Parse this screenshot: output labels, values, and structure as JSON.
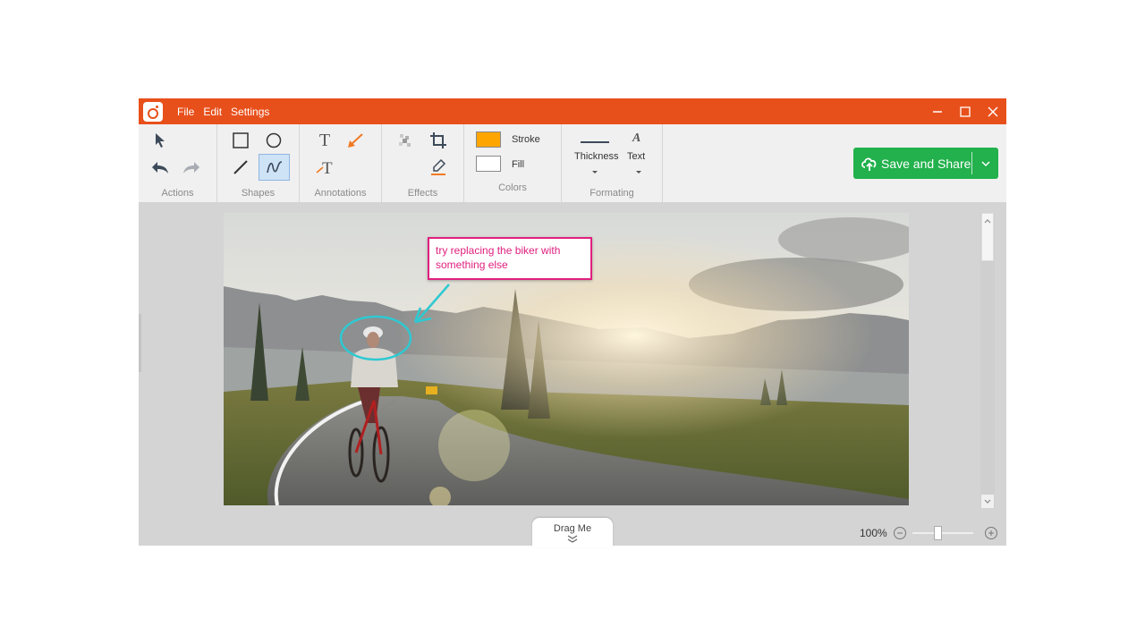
{
  "window": {
    "menu": [
      "File",
      "Edit",
      "Settings"
    ],
    "controls": {
      "minimize": "minimize-icon",
      "maximize": "maximize-icon",
      "close": "close-icon"
    }
  },
  "toolbar": {
    "groups": {
      "actions": "Actions",
      "shapes": "Shapes",
      "annotations": "Annotations",
      "effects": "Effects",
      "colors": "Colors",
      "formatting": "Formating"
    },
    "colors": {
      "stroke_label": "Stroke",
      "fill_label": "Fill",
      "stroke_color": "#ffa500",
      "fill_color": "#ffffff"
    },
    "formatting": {
      "thickness_label": "Thickness",
      "text_label": "Text"
    },
    "save_button": "Save and Share",
    "active_tool": "freehand"
  },
  "canvas": {
    "annotation_text": "try replacing the biker with something else",
    "annotation_color": "#e0207f",
    "highlight_color": "#2ec9d2"
  },
  "footer": {
    "drag_label": "Drag Me",
    "zoom_level": "100%",
    "zoom_fraction": 0.42
  },
  "theme": {
    "accent": "#e8501b",
    "save_green": "#22b14c"
  }
}
